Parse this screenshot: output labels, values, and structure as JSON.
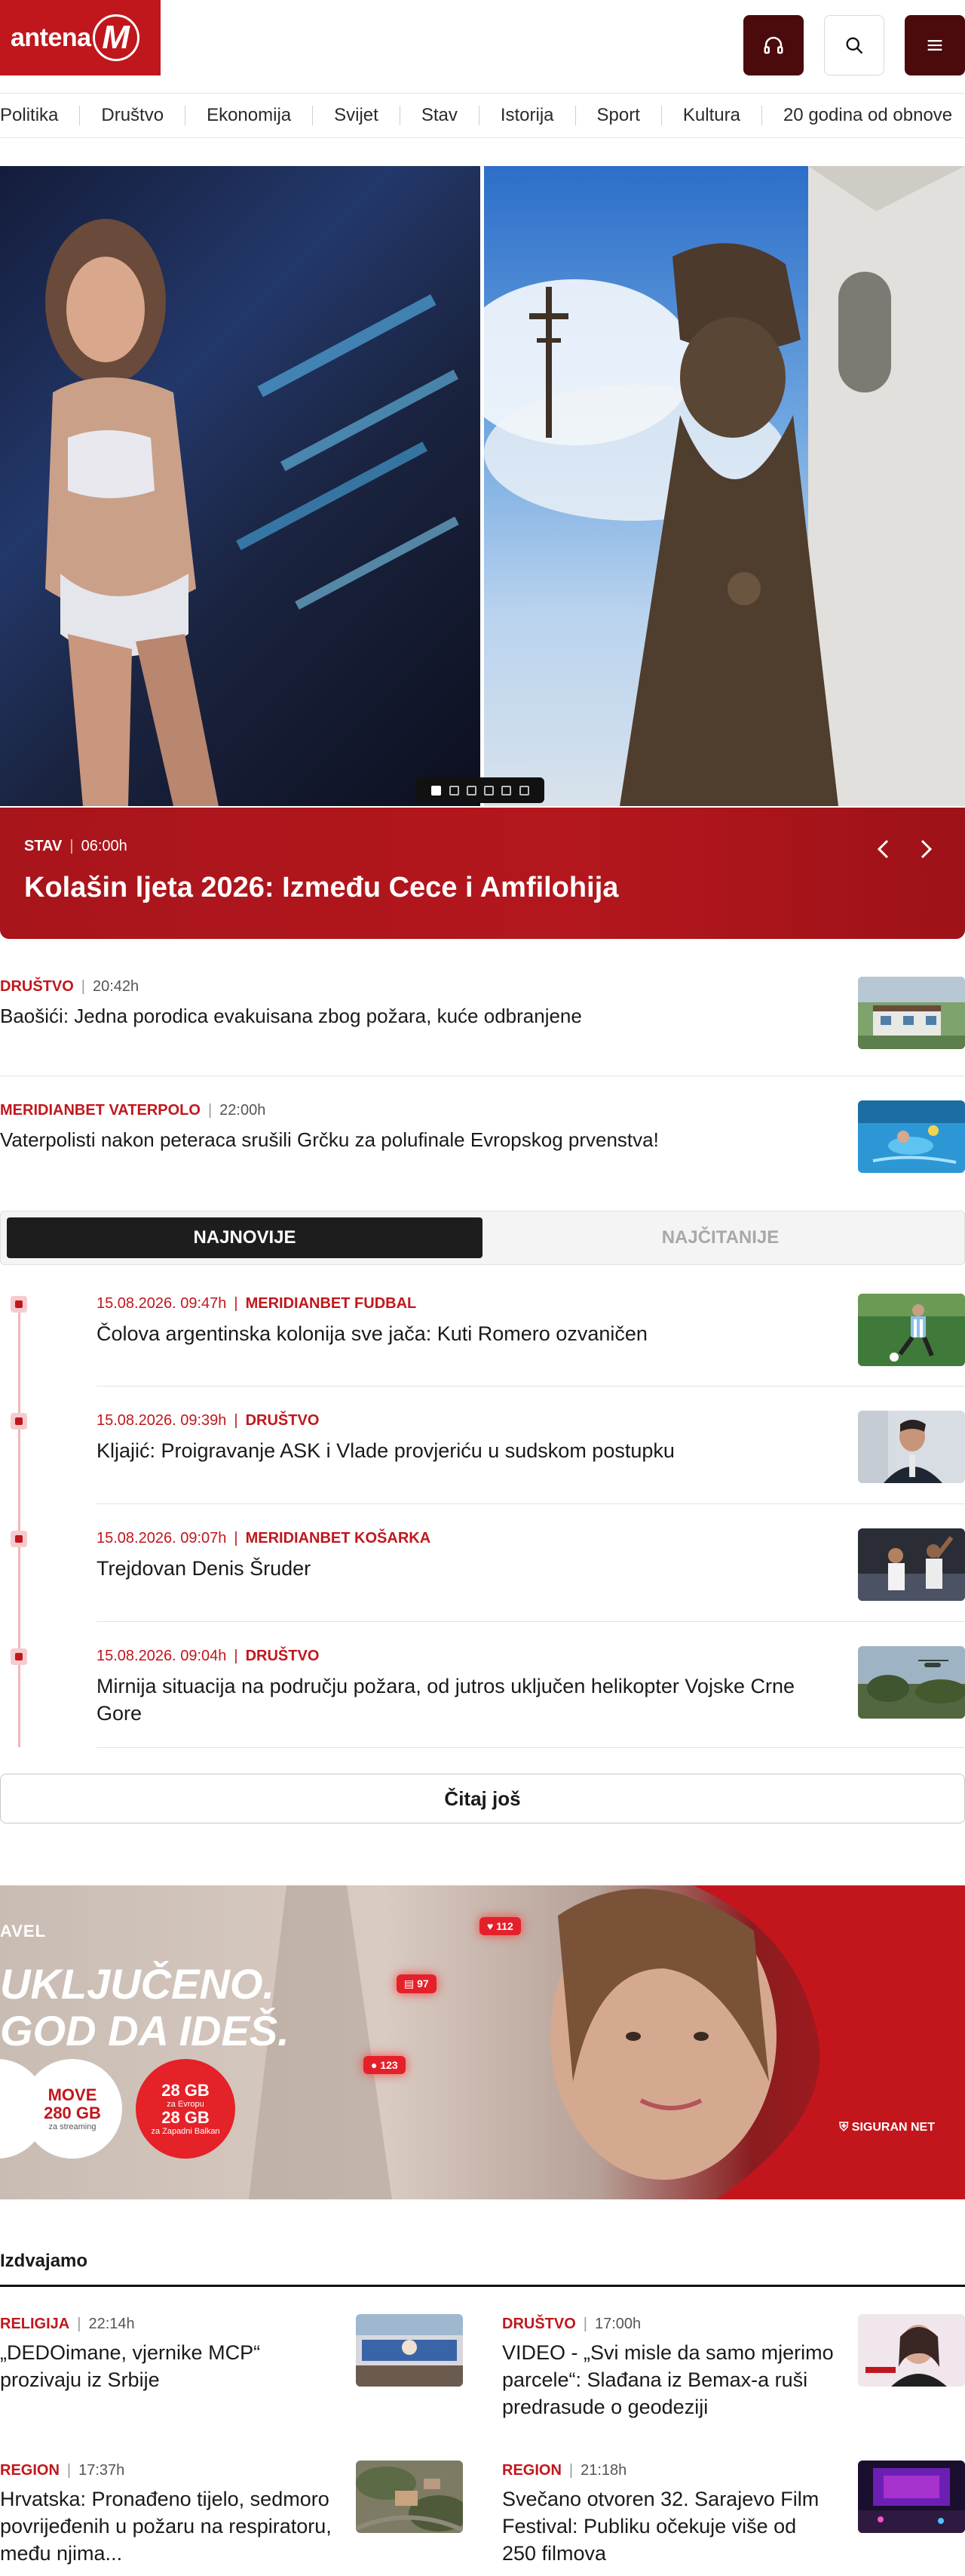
{
  "header": {
    "logo_text": "antena",
    "logo_m": "M"
  },
  "nav": [
    "Politika",
    "Društvo",
    "Ekonomija",
    "Svijet",
    "Stav",
    "Istorija",
    "Sport",
    "Kultura",
    "20 godina od obnove"
  ],
  "hero": {
    "category": "STAV",
    "time": "06:00h",
    "title": "Kolašin ljeta 2026: Između Cece i Amfilohija",
    "slides": 6,
    "active_slide": 0
  },
  "articles": [
    {
      "category": "DRUŠTVO",
      "time": "20:42h",
      "title": "Baošići: Jedna porodica evakuisana zbog požara, kuće odbranjene"
    },
    {
      "category": "MERIDIANBET VATERPOLO",
      "time": "22:00h",
      "title": "Vaterpolisti nakon peteraca srušili Grčku za polufinale Evropskog prvenstva!"
    }
  ],
  "tabs": {
    "latest": "NAJNOVIJE",
    "most_read": "NAJČITANIJE"
  },
  "timeline": [
    {
      "date": "15.08.2026. 09:47h",
      "category": "MERIDIANBET FUDBAL",
      "title": "Čolova argentinska kolonija sve jača: Kuti Romero ozvaničen"
    },
    {
      "date": "15.08.2026. 09:39h",
      "category": "DRUŠTVO",
      "title": "Kljajić: Proigravanje ASK i Vlade provjeriću u sudskom postupku"
    },
    {
      "date": "15.08.2026. 09:07h",
      "category": "MERIDIANBET KOŠARKA",
      "title": "Trejdovan Denis Šruder"
    },
    {
      "date": "15.08.2026. 09:04h",
      "category": "DRUŠTVO",
      "title": "Mirnija situacija na području požara, od jutros uključen helikopter Vojske Crne Gore"
    }
  ],
  "more_button": "Čitaj još",
  "ad": {
    "label": "AVEL",
    "headline_1": "UKLJUČENO.",
    "headline_2": "GOD DA IDEŠ.",
    "circle_1_big": "MOVE",
    "circle_1_mid": "280 GB",
    "circle_1_small": "za streaming",
    "circle_2_big": "28 GB",
    "circle_2_small_1": "za Evropu",
    "circle_2_mid": "28 GB",
    "circle_2_small_2": "za Zapadni Balkan",
    "bubble_1": "112",
    "bubble_2": "97",
    "bubble_3": "123",
    "brand": "SIGURAN NET"
  },
  "izdvajamo": {
    "title": "Izdvajamo",
    "items": [
      {
        "category": "RELIGIJA",
        "time": "22:14h",
        "title": "„DEDOimane, vjernike MCP“ prozivaju iz Srbije"
      },
      {
        "category": "DRUŠTVO",
        "time": "17:00h",
        "title": "VIDEO - „Svi misle da samo mjerimo parcele“: Slađana iz Bemax-a ruši predrasude o geodeziji"
      },
      {
        "category": "REGION",
        "time": "17:37h",
        "title": "Hrvatska: Pronađeno tijelo, sedmoro povrijeđenih u požaru na respiratoru, među njima..."
      },
      {
        "category": "REGION",
        "time": "21:18h",
        "title": "Svečano otvoren 32. Sarajevo Film Festival: Publiku očekuje više od 250 filmova"
      }
    ]
  }
}
